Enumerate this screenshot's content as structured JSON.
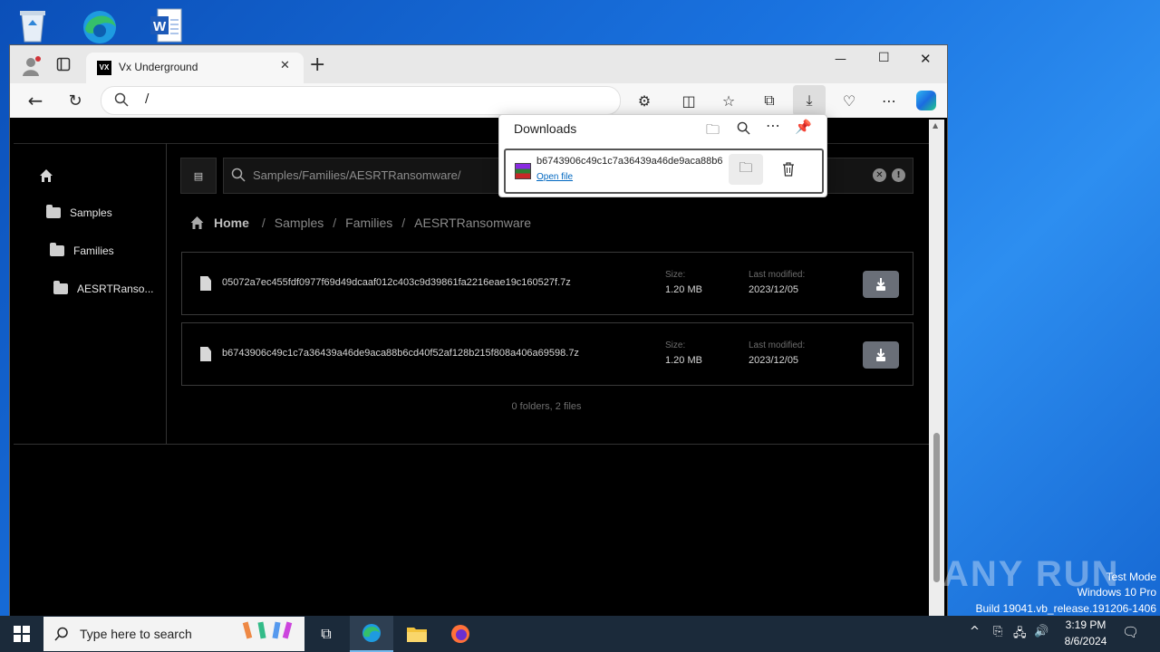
{
  "desktop": {
    "icons": [
      "recycle-bin",
      "microsoft-edge",
      "word-document"
    ],
    "watermark": {
      "logo": "ANY RUN",
      "line1": "Test Mode",
      "line2": "Windows 10 Pro",
      "line3": "Build 19041.vb_release.191206-1406"
    }
  },
  "browser": {
    "tab_title": "Vx Underground",
    "tab_favicon": "VX",
    "address": "/",
    "window_controls": {
      "minimize": "—",
      "maximize": "☐",
      "close": "✕"
    }
  },
  "downloads": {
    "title": "Downloads",
    "item_name": "b6743906c49c1c7a36439a46de9aca88b6",
    "item_action": "Open file"
  },
  "page": {
    "sidebar": {
      "items": [
        {
          "label": "Samples"
        },
        {
          "label": "Families"
        },
        {
          "label": "AESRTRanso..."
        }
      ]
    },
    "search": {
      "value": "Samples/Families/AESRTRansomware/"
    },
    "breadcrumb": {
      "home": "Home",
      "sep": "/",
      "parts": [
        "Samples",
        "Families",
        "AESRTRansomware"
      ]
    },
    "files": [
      {
        "name": "05072a7ec455fdf0977f69d49dcaaf012c403c9d39861fa2216eae19c160527f.7z",
        "size_label": "Size:",
        "size": "1.20 MB",
        "modified_label": "Last modified:",
        "modified": "2023/12/05"
      },
      {
        "name": "b6743906c49c1c7a36439a46de9aca88b6cd40f52af128b215f808a406a69598.7z",
        "size_label": "Size:",
        "size": "1.20 MB",
        "modified_label": "Last modified:",
        "modified": "2023/12/05"
      }
    ],
    "summary": "0 folders, 2 files"
  },
  "taskbar": {
    "search_placeholder": "Type here to search",
    "time": "3:19 PM",
    "date": "8/6/2024"
  },
  "colors": {
    "accent": "#0067c0",
    "page_bg": "#000000",
    "button_gray": "#6a6f78"
  }
}
